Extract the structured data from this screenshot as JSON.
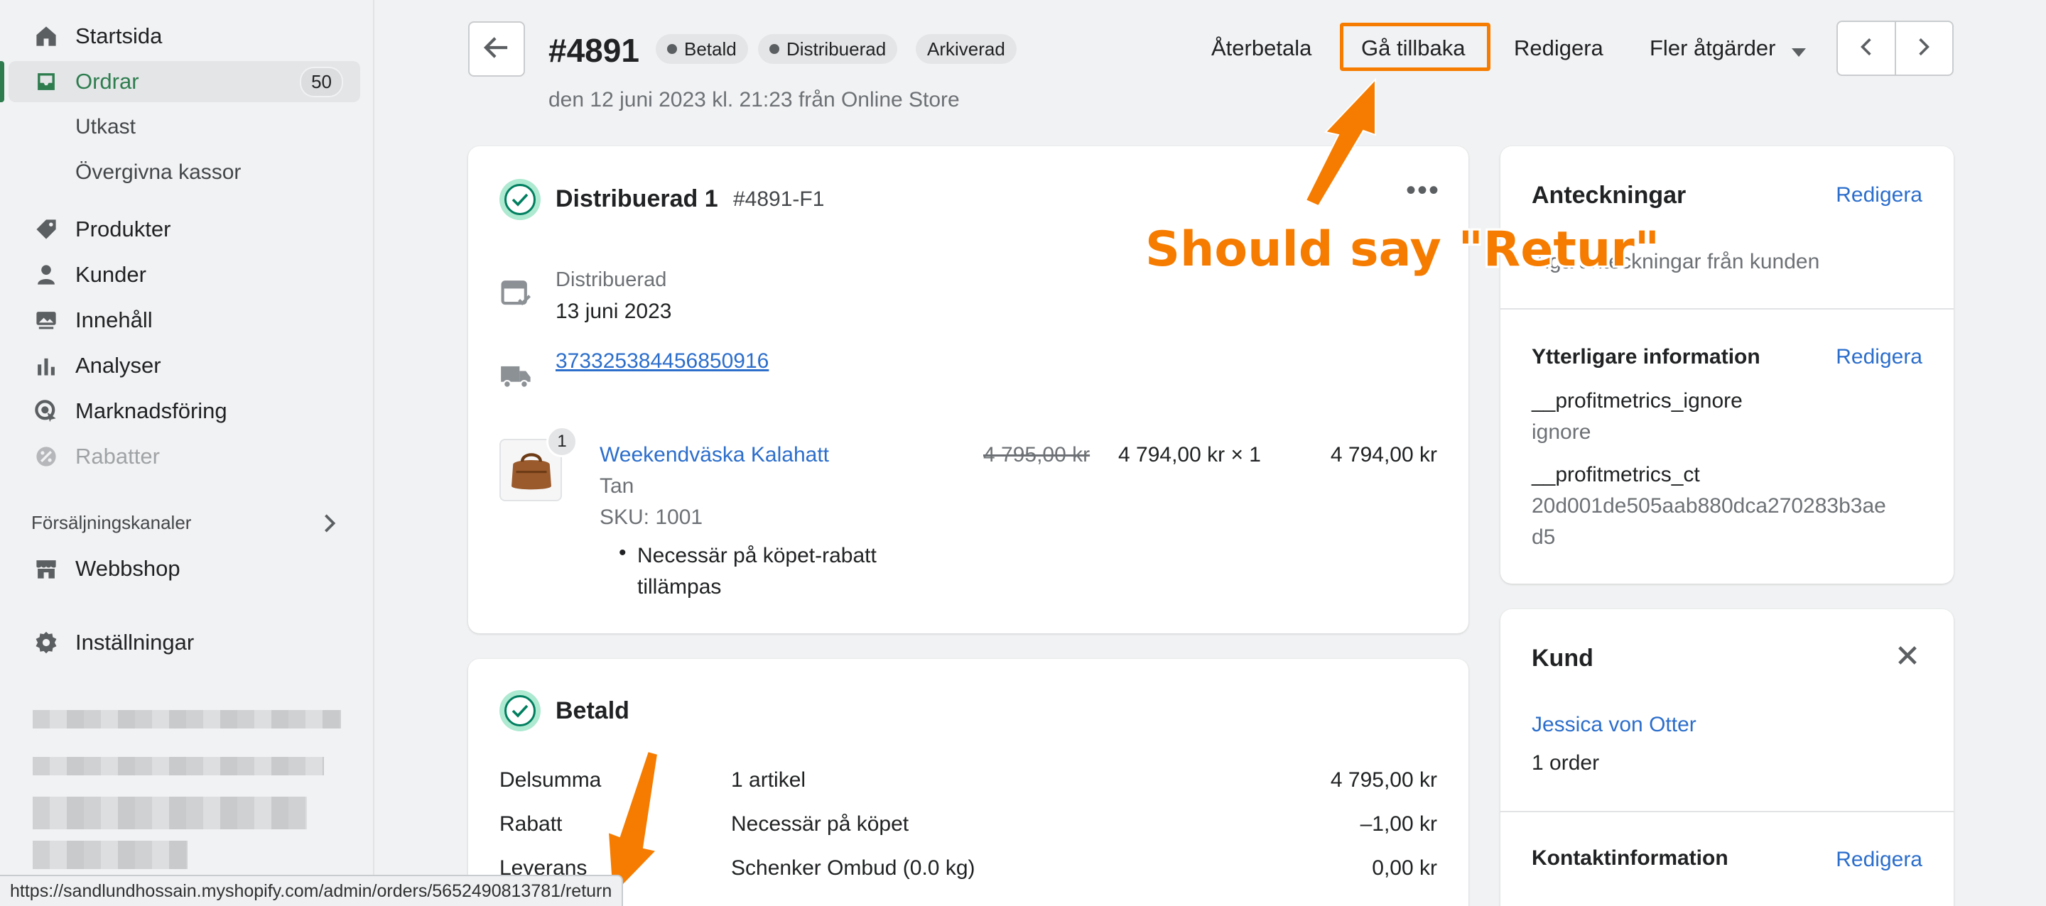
{
  "sidebar": {
    "items": [
      {
        "label": "Startsida",
        "icon": "home-icon"
      },
      {
        "label": "Ordrar",
        "icon": "orders-icon",
        "badge": "50"
      },
      {
        "label": "Produkter",
        "icon": "tag-icon"
      },
      {
        "label": "Kunder",
        "icon": "person-icon"
      },
      {
        "label": "Innehåll",
        "icon": "content-icon"
      },
      {
        "label": "Analyser",
        "icon": "bar-chart-icon"
      },
      {
        "label": "Marknadsföring",
        "icon": "target-icon"
      },
      {
        "label": "Rabatter",
        "icon": "discount-icon"
      }
    ],
    "sub_items": [
      "Utkast",
      "Övergivna kassor"
    ],
    "channels_label": "Försäljningskanaler",
    "webshop_label": "Webbshop",
    "settings_label": "Inställningar"
  },
  "header": {
    "order_number": "#4891",
    "tags": [
      "Betald",
      "Distribuerad",
      "Arkiverad"
    ],
    "subtitle": "den 12 juni 2023 kl. 21:23 från Online Store",
    "actions": {
      "refund": "Återbetala",
      "return": "Gå tillbaka",
      "edit": "Redigera",
      "more": "Fler åtgärder"
    }
  },
  "fulfillment": {
    "title": "Distribuerad 1",
    "code": "#4891-F1",
    "status_label": "Distribuerad",
    "date": "13 juni 2023",
    "tracking": "373325384456850916",
    "item": {
      "qty_badge": "1",
      "name": "Weekendväska Kalahatt",
      "variant": "Tan",
      "sku": "SKU: 1001",
      "discount_note_1": "Necessär på köpet-rabatt",
      "discount_note_2": "tillämpas",
      "original_price": "4 795,00 kr",
      "unit_price": "4 794,00 kr × 1",
      "total": "4 794,00 kr"
    }
  },
  "payment": {
    "title": "Betald",
    "rows": [
      {
        "label": "Delsumma",
        "desc": "1 artikel",
        "amount": "4 795,00 kr"
      },
      {
        "label": "Rabatt",
        "desc": "Necessär på köpet",
        "amount": "–1,00 kr"
      },
      {
        "label": "Leverans",
        "desc": "Schenker Ombud (0.0 kg)",
        "amount": "0,00 kr"
      }
    ]
  },
  "notes": {
    "title": "Anteckningar",
    "edit": "Redigera",
    "text": "Inga anteckningar från kunden"
  },
  "additional": {
    "title": "Ytterligare information",
    "edit": "Redigera",
    "key1": "__profitmetrics_ignore",
    "val1": "ignore",
    "key2": "__profitmetrics_ct",
    "val2_line1": "20d001de505aab880dca270283b3ae",
    "val2_line2": "d5"
  },
  "customer": {
    "title": "Kund",
    "name": "Jessica von Otter",
    "orders": "1 order",
    "contact_title": "Kontaktinformation",
    "contact_edit": "Redigera"
  },
  "annotation": "Should say \"Retur\"",
  "status_url": "https://sandlundhossain.myshopify.com/admin/orders/5652490813781/return",
  "colors": {
    "accent": "#f57c00",
    "link": "#2c6ecb",
    "active_green": "#2e7d4f"
  }
}
